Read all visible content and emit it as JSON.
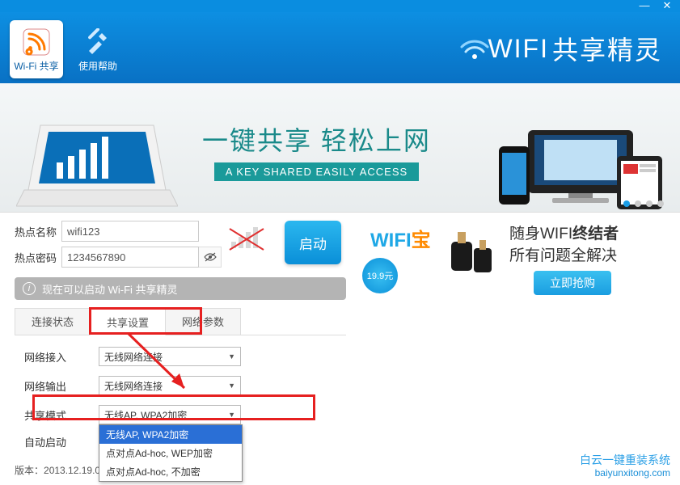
{
  "titlebar": {
    "minimize": "—",
    "close": "✕"
  },
  "header": {
    "tab1": "Wi-Fi 共享",
    "tab2": "使用帮助",
    "logo_prefix": "WIFI",
    "logo_suffix": "共享精灵"
  },
  "banner": {
    "cn": "一键共享 轻松上网",
    "en": "A KEY SHARED EASILY ACCESS"
  },
  "form": {
    "name_label": "热点名称",
    "name_value": "wifi123",
    "pwd_label": "热点密码",
    "pwd_value": "1234567890",
    "start": "启动"
  },
  "status": "现在可以启动 Wi-Fi 共享精灵",
  "tabs": {
    "t1": "连接状态",
    "t2": "共享设置",
    "t3": "网络参数"
  },
  "settings": {
    "net_in_label": "网络接入",
    "net_in_value": "无线网络连接",
    "net_out_label": "网络输出",
    "net_out_value": "无线网络连接",
    "mode_label": "共享模式",
    "mode_value": "无线AP, WPA2加密",
    "auto_label": "自动启动",
    "options": {
      "o1": "无线AP, WPA2加密",
      "o2": "点对点Ad-hoc, WEP加密",
      "o3": "点对点Ad-hoc, 不加密"
    }
  },
  "promo": {
    "wifi": "WIFI",
    "bao": "宝",
    "price": "19.9元",
    "line1a": "随身WIFI",
    "line1b": "终结者",
    "line2": "所有问题全解决",
    "buy": "立即抢购"
  },
  "footer": {
    "version_label": "版本：",
    "version": "2013.12.19.001"
  },
  "watermark": {
    "cn": "白云一键重装系统",
    "url": "baiyunxitong.com"
  }
}
